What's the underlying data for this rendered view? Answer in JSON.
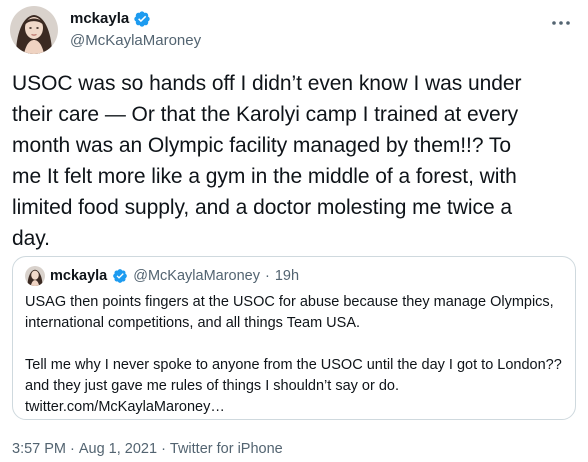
{
  "author": {
    "display_name": "mckayla",
    "handle": "@McKaylaMaroney",
    "verified": true,
    "avatar_icon": "profile-photo"
  },
  "tweet": {
    "text": "USOC was so hands off I didn’t even know I was under\ntheir care — Or that the Karolyi camp I trained at every\nmonth was an Olympic facility managed by them!!? To\nme It felt more like a gym in the middle of a forest, with\nlimited food supply, and a doctor molesting me twice a\nday."
  },
  "quoted_tweet": {
    "display_name": "mckayla",
    "handle": "@McKaylaMaroney",
    "separator": "·",
    "time": "19h",
    "paragraphs": [
      "USAG then points fingers at the USOC for abuse because they manage Olympics, international competitions, and all things Team USA.",
      "Tell me why I never spoke to anyone from the USOC until the day I got to London?? and they just gave me rules of things I shouldn’t say or do. twitter.com/McKaylaMaroney…"
    ]
  },
  "footer": {
    "time": "3:57 PM",
    "sep1": "·",
    "date": "Aug 1, 2021",
    "sep2": "·",
    "source": "Twitter for iPhone"
  },
  "colors": {
    "text": "#0f1419",
    "secondary": "#536471",
    "verified": "#1d9bf0",
    "border": "#cfd9de"
  }
}
